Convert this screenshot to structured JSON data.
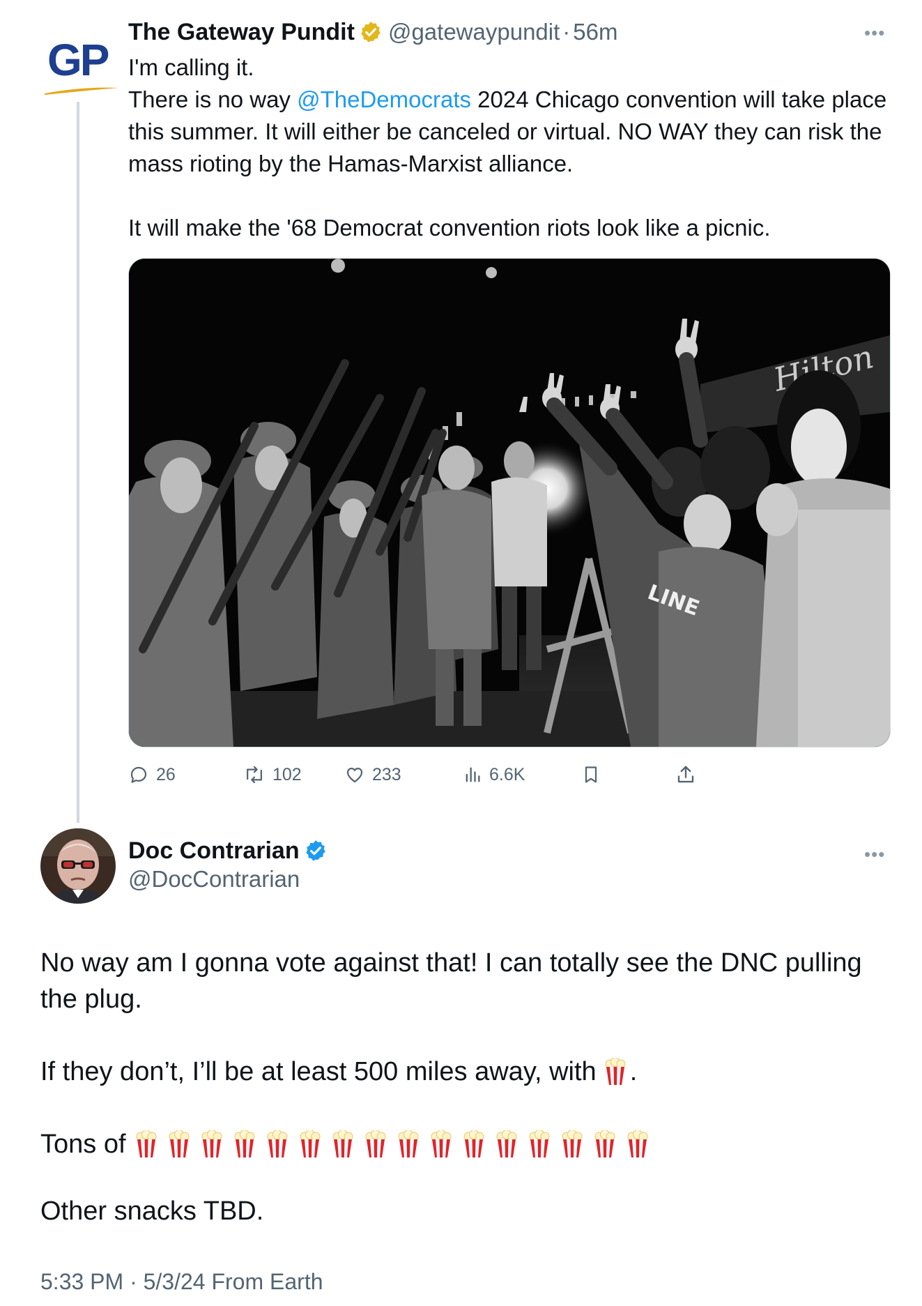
{
  "tweet": {
    "logo_text": "GP",
    "author_name": "The Gateway Pundit",
    "author_handle": "@gatewaypundit",
    "separator": "·",
    "time_ago": "56m",
    "more_label": "•••",
    "text_line1": "I'm calling it.",
    "text_line2_pre": "There is no way ",
    "mention": "@TheDemocrats",
    "text_line2_post": " 2024 Chicago convention will take place this summer. It will either be canceled or virtual. NO WAY they can risk the mass rioting by the Hamas-Marxist alliance.",
    "text_line3": "It will make the '68 Democrat convention riots look like a picnic.",
    "stats": {
      "replies": "26",
      "retweets": "102",
      "likes": "233",
      "views": "6.6K"
    },
    "badge_color": "#e2b719"
  },
  "reply": {
    "author_name": "Doc Contrarian",
    "author_handle": "@DocContrarian",
    "more_label": "•••",
    "paragraph1": "No way am I gonna vote against that! I can totally see the DNC pulling the plug.",
    "paragraph2_pre": "If they don’t, I’ll be at least 500 miles away, with",
    "paragraph2_post": ".",
    "paragraph3_pre": "Tons of",
    "popcorn_count": 16,
    "paragraph4": "Other snacks TBD.",
    "timestamp": "5:33 PM · 5/3/24 From Earth",
    "badge_color": "#1d9bf0"
  },
  "icons": {
    "reply": "reply-bubble-icon",
    "retweet": "retweet-icon",
    "like": "heart-icon",
    "views": "views-bar-icon",
    "bookmark": "bookmark-icon",
    "share": "share-icon",
    "emoji": "popcorn"
  }
}
